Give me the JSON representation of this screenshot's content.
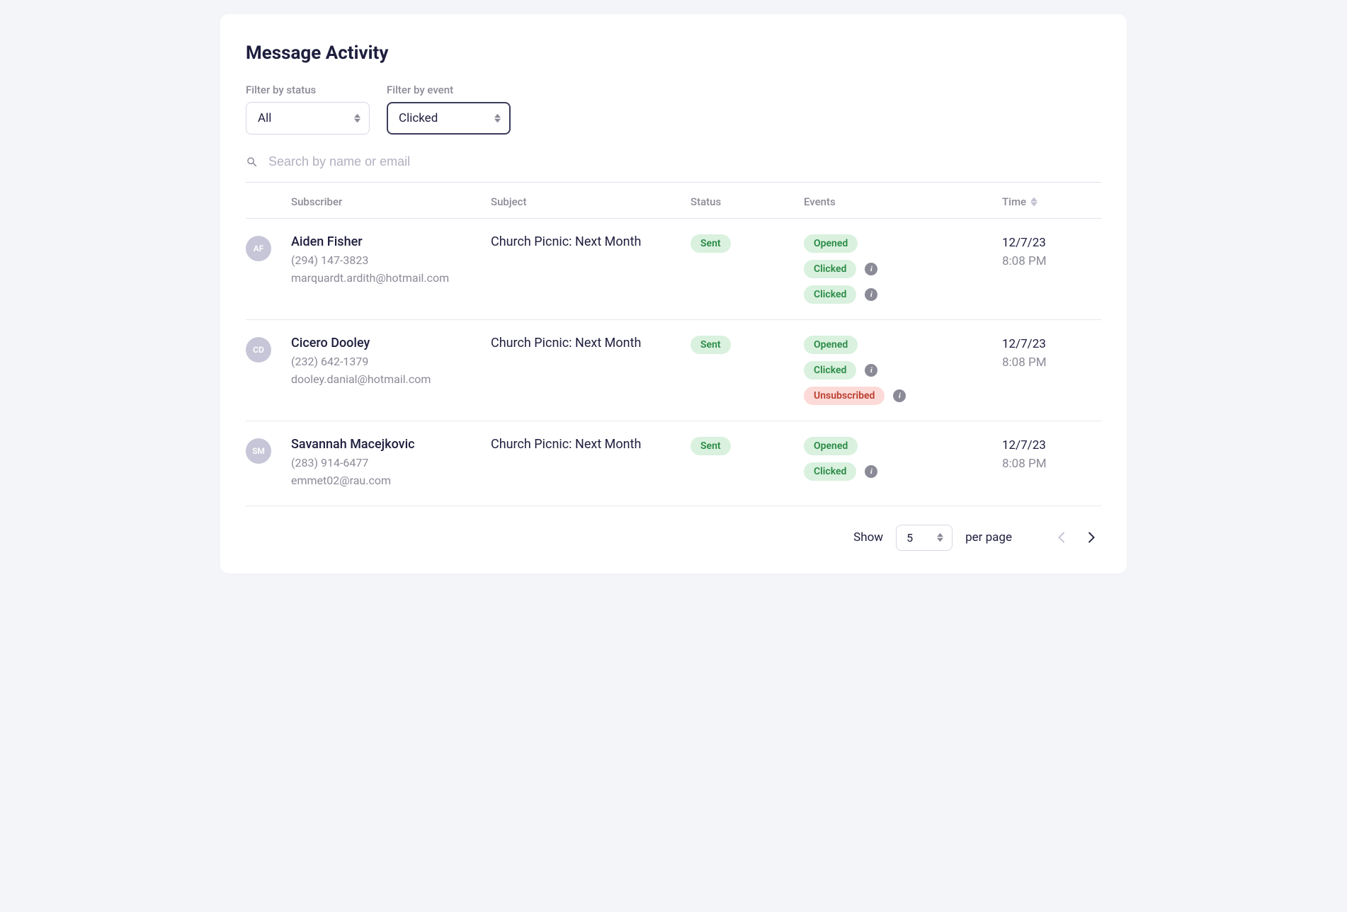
{
  "title": "Message Activity",
  "filters": {
    "status_label": "Filter by status",
    "status_value": "All",
    "event_label": "Filter by event",
    "event_value": "Clicked"
  },
  "search": {
    "placeholder": "Search by name or email"
  },
  "columns": {
    "subscriber": "Subscriber",
    "subject": "Subject",
    "status": "Status",
    "events": "Events",
    "time": "Time"
  },
  "rows": [
    {
      "initials": "AF",
      "name": "Aiden Fisher",
      "phone": "(294) 147-3823",
      "email": "marquardt.ardith@hotmail.com",
      "subject": "Church Picnic: Next Month",
      "status": "Sent",
      "events": [
        {
          "label": "Opened",
          "type": "opened",
          "info": false
        },
        {
          "label": "Clicked",
          "type": "clicked",
          "info": true
        },
        {
          "label": "Clicked",
          "type": "clicked",
          "info": true
        }
      ],
      "date": "12/7/23",
      "time": "8:08 PM"
    },
    {
      "initials": "CD",
      "name": "Cicero Dooley",
      "phone": "(232) 642-1379",
      "email": "dooley.danial@hotmail.com",
      "subject": "Church Picnic: Next Month",
      "status": "Sent",
      "events": [
        {
          "label": "Opened",
          "type": "opened",
          "info": false
        },
        {
          "label": "Clicked",
          "type": "clicked",
          "info": true
        },
        {
          "label": "Unsubscribed",
          "type": "unsub",
          "info": true
        }
      ],
      "date": "12/7/23",
      "time": "8:08 PM"
    },
    {
      "initials": "SM",
      "name": "Savannah Macejkovic",
      "phone": "(283) 914-6477",
      "email": "emmet02@rau.com",
      "subject": "Church Picnic: Next Month",
      "status": "Sent",
      "events": [
        {
          "label": "Opened",
          "type": "opened",
          "info": false
        },
        {
          "label": "Clicked",
          "type": "clicked",
          "info": true
        }
      ],
      "date": "12/7/23",
      "time": "8:08 PM"
    }
  ],
  "pager": {
    "show_label": "Show",
    "per_page_label": "per page",
    "value": "5"
  }
}
